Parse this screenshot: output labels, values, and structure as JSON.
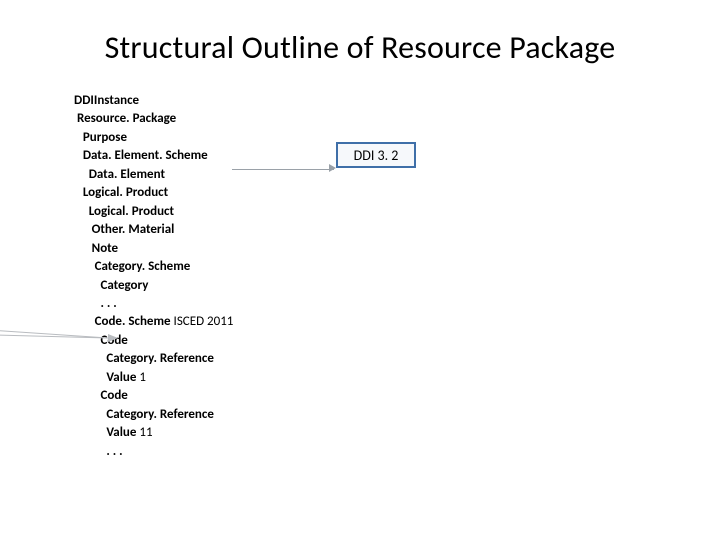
{
  "title": "Structural Outline of Resource Package",
  "badge": {
    "label": "DDI 3. 2"
  },
  "outline": {
    "l0": "DDIInstance",
    "l1": " Resource. Package",
    "l2": "   Purpose",
    "l3": "   Data. Element. Scheme",
    "l4": "     Data. Element",
    "l5": "   Logical. Product",
    "l6": "     Logical. Product",
    "l7": "      Other. Material",
    "l8": "      Note",
    "l9": "       Category. Scheme",
    "l10": "         Category",
    "l11": "         . . .",
    "l12": "       Code. Scheme ",
    "l12b": "ISCED 2011",
    "l13": "         Code",
    "l14": "           Category. Reference",
    "l15": "           Value ",
    "l15v": "1",
    "l16": "         Code",
    "l17": "           Category. Reference",
    "l18": "           Value ",
    "l18v": "11",
    "l19": "           . . ."
  }
}
